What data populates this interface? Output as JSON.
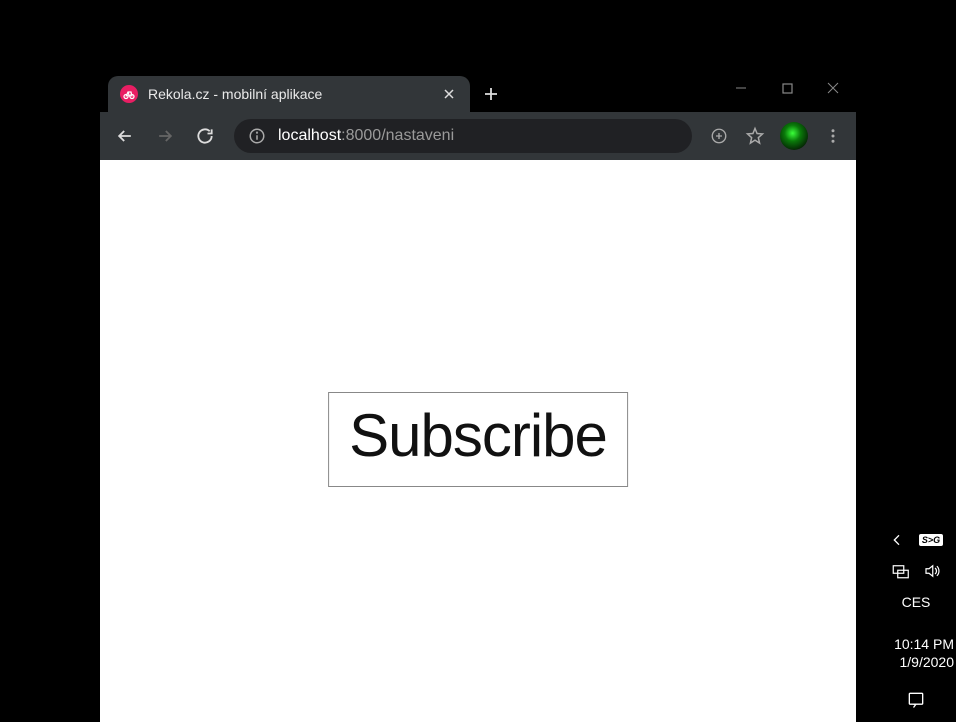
{
  "tab": {
    "title": "Rekola.cz - mobilní aplikace",
    "favicon_name": "bike-icon"
  },
  "address": {
    "host": "localhost",
    "port_path": ":8000/nastaveni"
  },
  "page": {
    "subscribe_label": "Subscribe"
  },
  "system": {
    "ime": "CES",
    "time": "10:14 PM",
    "date": "1/9/2020",
    "badge": "S>G"
  }
}
